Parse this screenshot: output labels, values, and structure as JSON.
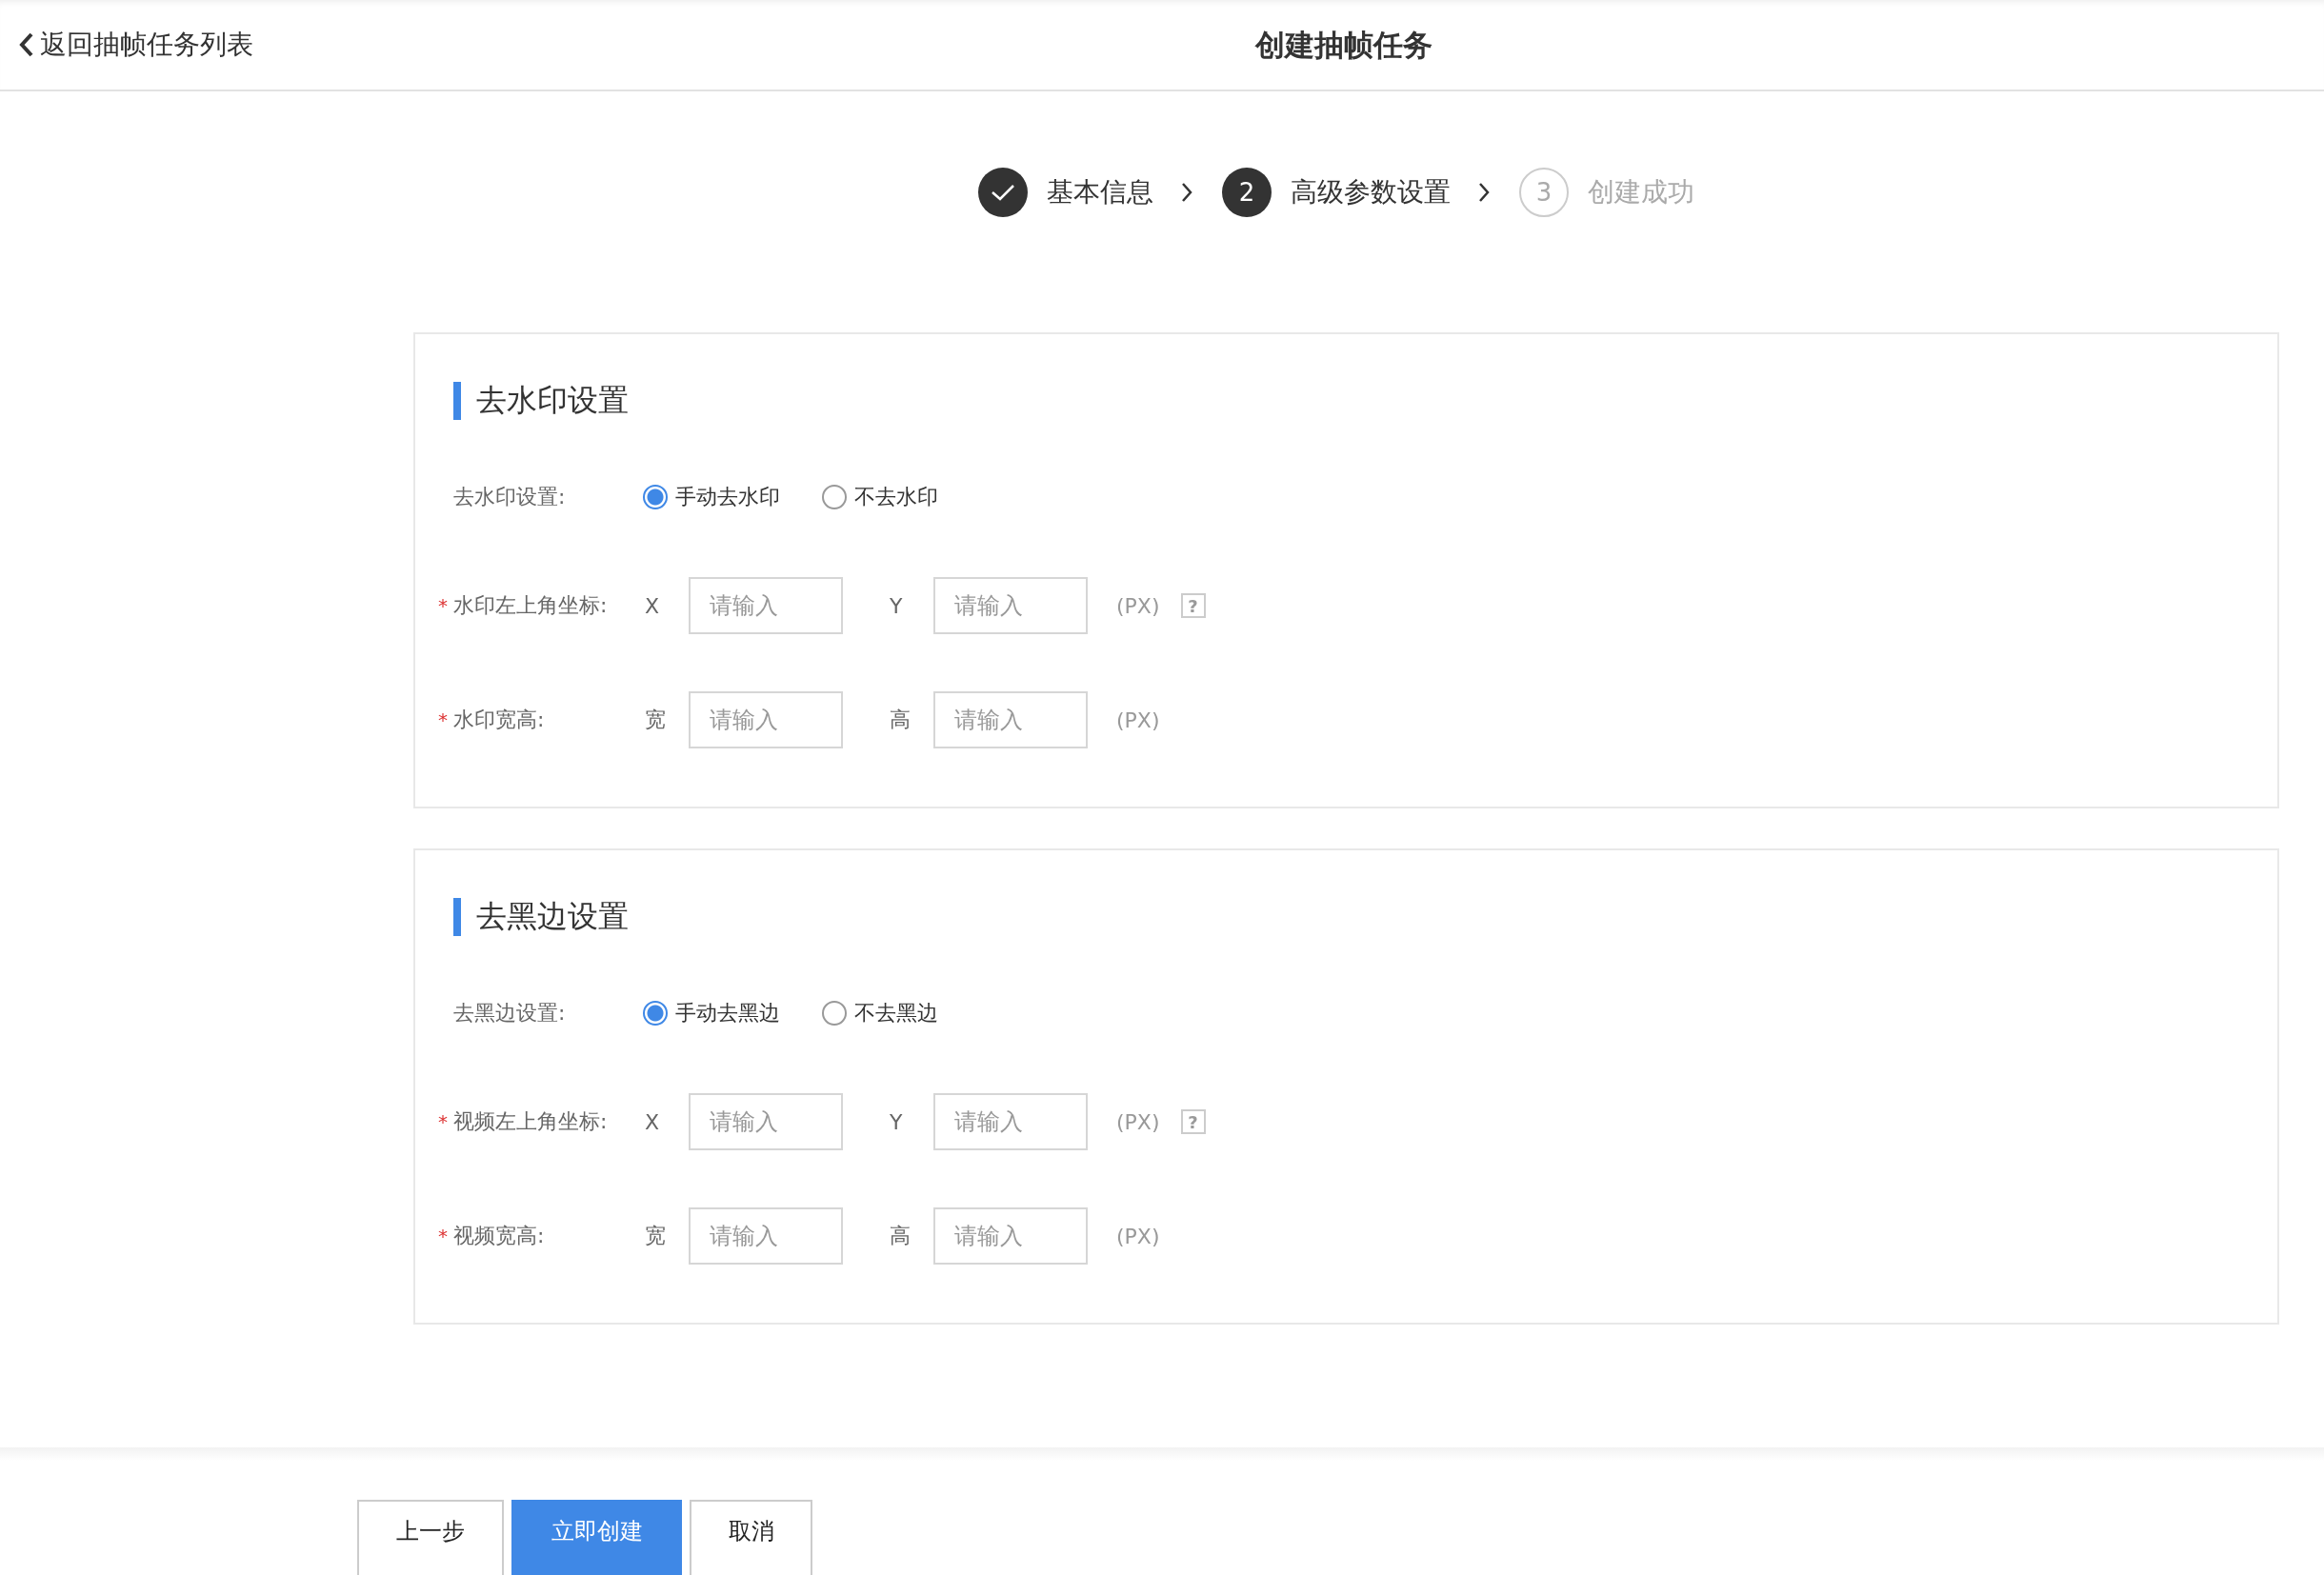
{
  "header": {
    "back_link": "返回抽帧任务列表",
    "title": "创建抽帧任务"
  },
  "steps": [
    {
      "kind": "done",
      "label": "基本信息"
    },
    {
      "kind": "active",
      "number": "2",
      "label": "高级参数设置"
    },
    {
      "kind": "pending",
      "number": "3",
      "label": "创建成功"
    }
  ],
  "sections": [
    {
      "title": "去水印设置",
      "mode_label": "去水印设置:",
      "mode_options": [
        {
          "label": "手动去水印",
          "selected": true
        },
        {
          "label": "不去水印",
          "selected": false
        }
      ],
      "rows": [
        {
          "required_mark": "*",
          "label": "水印左上角坐标:",
          "fields": [
            {
              "axis": "X",
              "placeholder": "请输入"
            },
            {
              "axis": "Y",
              "placeholder": "请输入"
            }
          ],
          "unit": "(PX)",
          "help": "?"
        },
        {
          "required_mark": "*",
          "label": "水印宽高:",
          "fields": [
            {
              "axis": "宽",
              "placeholder": "请输入"
            },
            {
              "axis": "高",
              "placeholder": "请输入"
            }
          ],
          "unit": "(PX)"
        }
      ]
    },
    {
      "title": "去黑边设置",
      "mode_label": "去黑边设置:",
      "mode_options": [
        {
          "label": "手动去黑边",
          "selected": true
        },
        {
          "label": "不去黑边",
          "selected": false
        }
      ],
      "rows": [
        {
          "required_mark": "*",
          "label": "视频左上角坐标:",
          "fields": [
            {
              "axis": "X",
              "placeholder": "请输入"
            },
            {
              "axis": "Y",
              "placeholder": "请输入"
            }
          ],
          "unit": "(PX)",
          "help": "?"
        },
        {
          "required_mark": "*",
          "label": "视频宽高:",
          "fields": [
            {
              "axis": "宽",
              "placeholder": "请输入"
            },
            {
              "axis": "高",
              "placeholder": "请输入"
            }
          ],
          "unit": "(PX)"
        }
      ]
    }
  ],
  "buttons": [
    {
      "kind": "default",
      "label": "上一步"
    },
    {
      "kind": "primary",
      "label": "立即创建"
    },
    {
      "kind": "default",
      "label": "取消"
    }
  ]
}
